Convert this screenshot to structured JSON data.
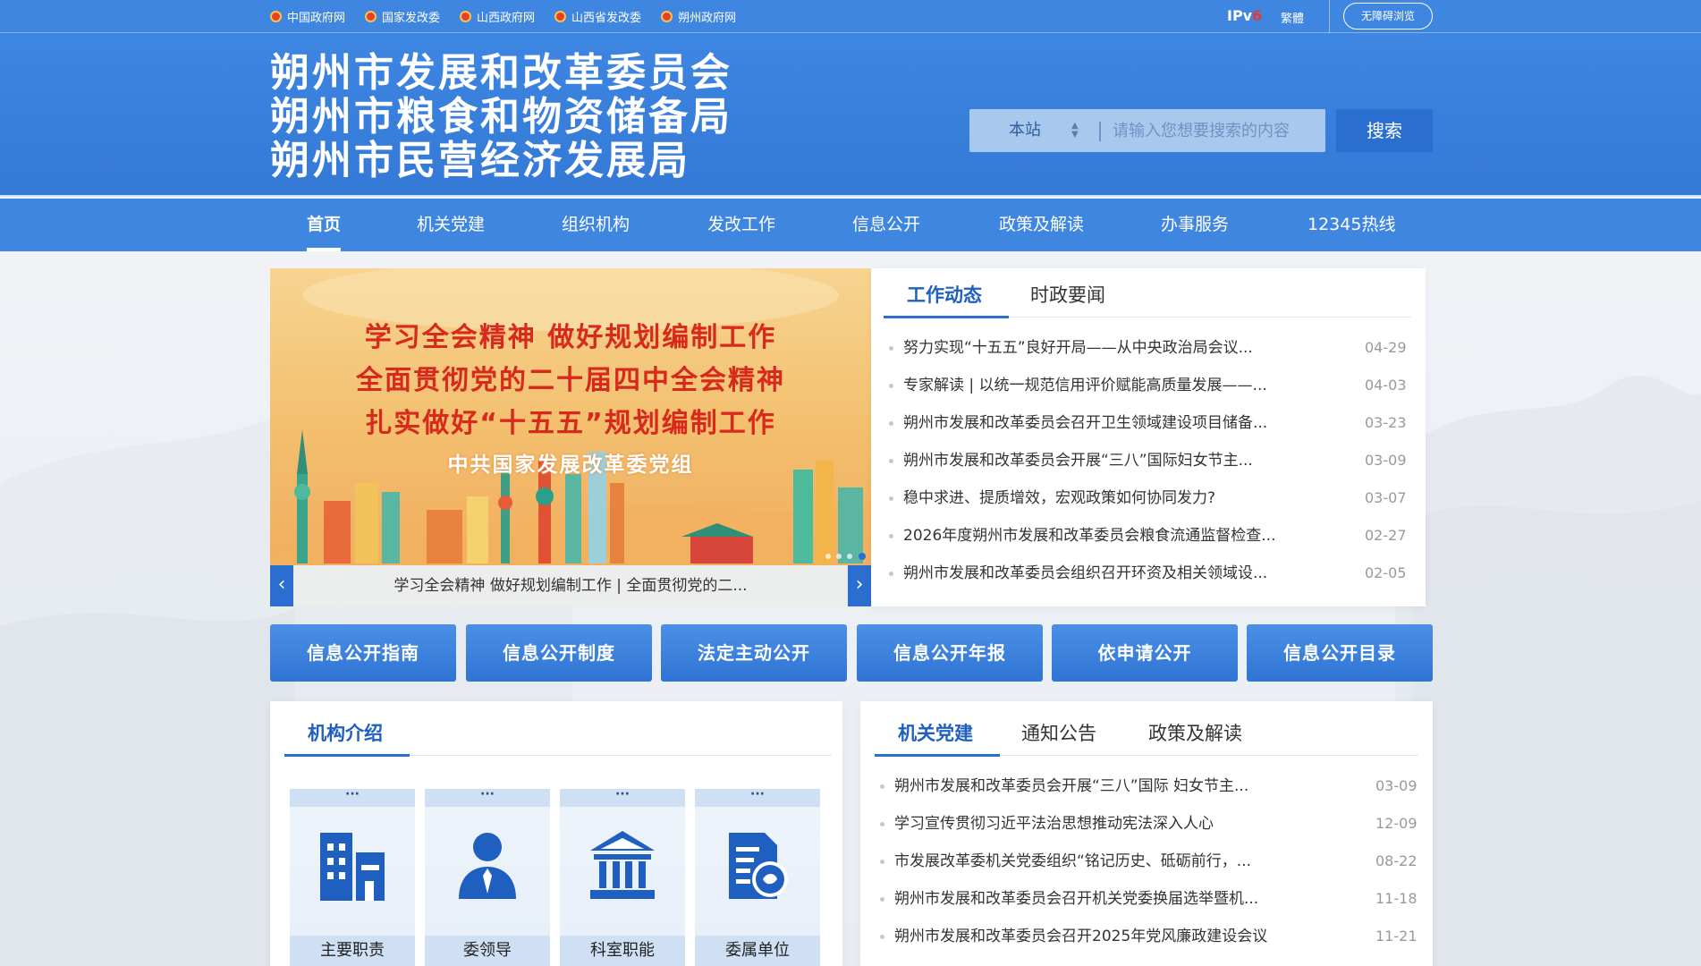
{
  "topbar": {
    "links": [
      "中国政府网",
      "国家发改委",
      "山西政府网",
      "山西省发改委",
      "朔州政府网"
    ],
    "ipv6_main": "IPv",
    "ipv6_six": "6",
    "traditional": "繁體",
    "accessibility": "无障碍浏览"
  },
  "header": {
    "titles": [
      "朔州市发展和改革委员会",
      "朔州市粮食和物资储备局",
      "朔州市民营经济发展局"
    ],
    "search_scope": "本站",
    "search_placeholder": "请输入您想要搜索的内容",
    "search_button": "搜索"
  },
  "nav": {
    "items": [
      "首页",
      "机关党建",
      "组织机构",
      "发改工作",
      "信息公开",
      "政策及解读",
      "办事服务",
      "12345热线"
    ]
  },
  "carousel": {
    "slogans": [
      "学习全会精神 做好规划编制工作",
      "全面贯彻党的二十届四中全会精神",
      "扎实做好“十五五”规划编制工作"
    ],
    "org": "中共国家发展改革委党组",
    "caption": "学习全会精神 做好规划编制工作 | 全面贯彻党的二...",
    "prev": "‹",
    "next": "›"
  },
  "news": {
    "tabs": [
      "工作动态",
      "时政要闻"
    ],
    "items": [
      {
        "title": "努力实现“十五五”良好开局——从中央政治局会议...",
        "date": "04-29"
      },
      {
        "title": "专家解读 | 以统一规范信用评价赋能高质量发展——...",
        "date": "04-03"
      },
      {
        "title": "朔州市发展和改革委员会召开卫生领域建设项目储备...",
        "date": "03-23"
      },
      {
        "title": "朔州市发展和改革委员会开展“三八”国际妇女节主...",
        "date": "03-09"
      },
      {
        "title": "稳中求进、提质增效，宏观政策如何协同发力?",
        "date": "03-07"
      },
      {
        "title": "2026年度朔州市发展和改革委员会粮食流通监督检查...",
        "date": "02-27"
      },
      {
        "title": "朔州市发展和改革委员会组织召开环资及相关领域设...",
        "date": "02-05"
      }
    ]
  },
  "info_buttons": [
    "信息公开指南",
    "信息公开制度",
    "法定主动公开",
    "信息公开年报",
    "依申请公开",
    "信息公开目录"
  ],
  "org": {
    "tab": "机构介绍",
    "cards": [
      {
        "label": "主要职责",
        "icon": "building-icon"
      },
      {
        "label": "委领导",
        "icon": "leader-icon"
      },
      {
        "label": "科室职能",
        "icon": "institution-icon"
      },
      {
        "label": "委属单位",
        "icon": "document-icon"
      }
    ],
    "more": "···"
  },
  "party": {
    "tabs": [
      "机关党建",
      "通知公告",
      "政策及解读"
    ],
    "items": [
      {
        "title": "朔州市发展和改革委员会开展“三八”国际 妇女节主...",
        "date": "03-09"
      },
      {
        "title": "学习宣传贯彻习近平法治思想推动宪法深入人心",
        "date": "12-09"
      },
      {
        "title": "市发展改革委机关党委组织“铭记历史、砥砺前行，...",
        "date": "08-22"
      },
      {
        "title": "朔州市发展和改革委员会召开机关党委换届选举暨机...",
        "date": "11-18"
      },
      {
        "title": "朔州市发展和改革委员会召开2025年党风廉政建设会议",
        "date": "11-21"
      }
    ]
  },
  "colors": {
    "primary": "#3f86e0",
    "dark_primary": "#2a6fd0",
    "slogan_red": "#d8291d"
  }
}
